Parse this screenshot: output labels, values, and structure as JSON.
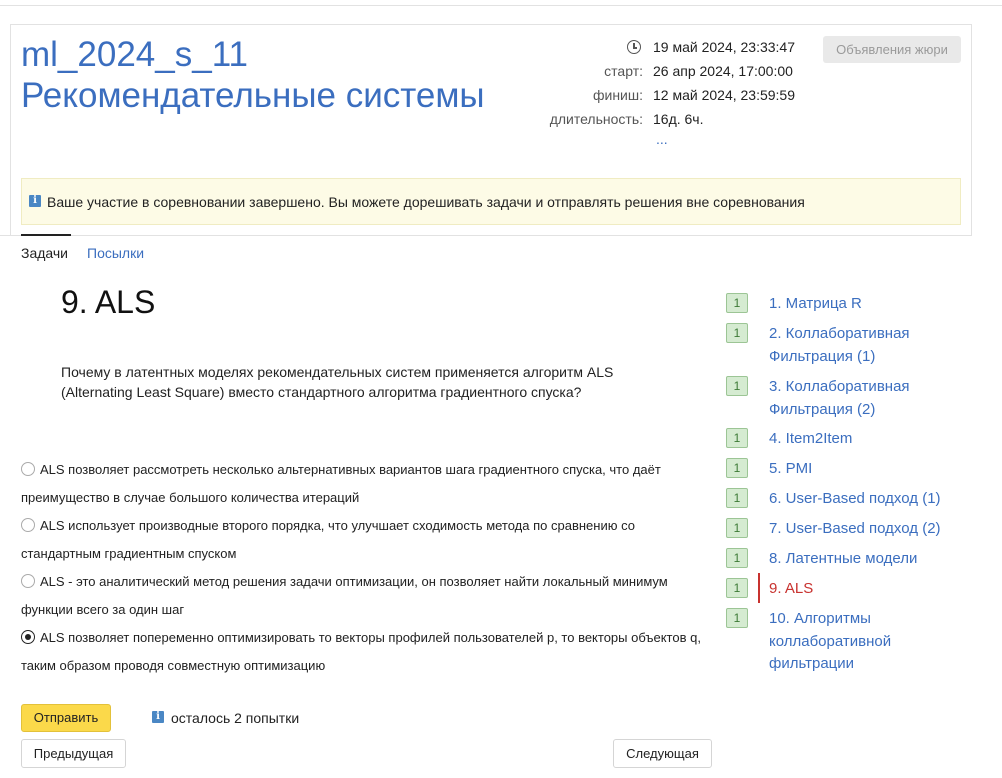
{
  "header": {
    "contest_code": "ml_2024_s_11",
    "contest_name": "Рекомендательные системы",
    "current_time": "19 май 2024, 23:33:47",
    "start_label": "старт:",
    "start_value": "26 апр 2024, 17:00:00",
    "finish_label": "финиш:",
    "finish_value": "12 май 2024, 23:59:59",
    "duration_label": "длительность:",
    "duration_value": "16д. 6ч.",
    "more": "...",
    "jury_button": "Объявления жюри"
  },
  "notice": {
    "icon": "info-icon",
    "text": "Ваше участие в соревновании завершено. Вы можете дорешивать задачи и отправлять решения вне соревнования"
  },
  "tabs": [
    {
      "label": "Задачи",
      "active": true
    },
    {
      "label": "Посылки",
      "active": false
    }
  ],
  "problem": {
    "title": "9. ALS",
    "statement": "Почему в латентных моделях рекомендательных систем применяется алгоритм ALS (Alternating Least Square) вместо стандартного алгоритма градиентного спуска?",
    "options": [
      {
        "text": "ALS позволяет рассмотреть несколько альтернативных вариантов шага градиентного спуска, что даёт преимущество в случае большого количества итераций",
        "selected": false
      },
      {
        "text": "ALS использует производные второго порядка, что улучшает сходимость метода по сравнению со стандартным градиентным спуском",
        "selected": false
      },
      {
        "text": "ALS - это аналитический метод решения задачи оптимизации, он позволяет найти локальный минимум функции всего за один шаг",
        "selected": false
      },
      {
        "text": "ALS позволяет попеременно оптимизировать то векторы профилей пользователей p, то векторы объектов q, таким образом проводя совместную оптимизацию",
        "selected": true
      }
    ],
    "submit_label": "Отправить",
    "attempts_text": "осталось 2 попытки",
    "prev_label": "Предыдущая",
    "next_label": "Следующая"
  },
  "problem_list": [
    {
      "badge": "1",
      "label": "1. Матрица R"
    },
    {
      "badge": "1",
      "label": "2. Коллаборативная Фильтрация (1)"
    },
    {
      "badge": "1",
      "label": "3. Коллаборативная Фильтрация (2)"
    },
    {
      "badge": "1",
      "label": "4. Item2Item"
    },
    {
      "badge": "1",
      "label": "5. PMI"
    },
    {
      "badge": "1",
      "label": "6. User-Based подход (1)"
    },
    {
      "badge": "1",
      "label": "7. User-Based подход (2)"
    },
    {
      "badge": "1",
      "label": "8. Латентные модели"
    },
    {
      "badge": "1",
      "label": "9. ALS",
      "current": true
    },
    {
      "badge": "1",
      "label": "10. Алгоритмы коллаборативной фильтрации"
    }
  ],
  "colors": {
    "link": "#3b6ebf",
    "current": "#c8322f",
    "submit": "#fbd94a",
    "badge_bg": "#d5ebd1",
    "notice_bg": "#fdfbe6"
  }
}
